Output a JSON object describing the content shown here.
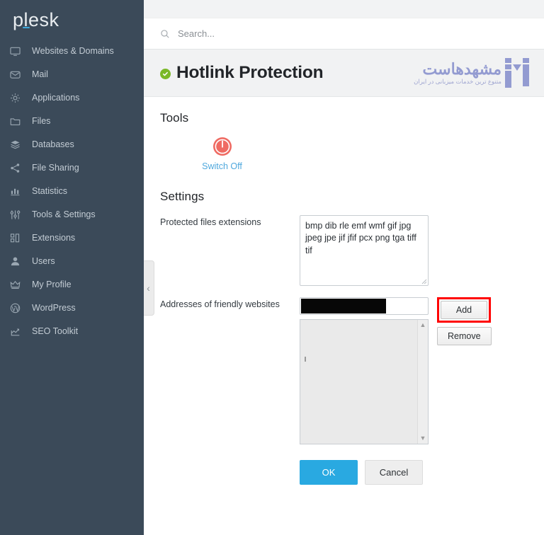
{
  "sidebar": {
    "brand": "plesk",
    "items": [
      {
        "label": "Websites & Domains",
        "icon": "monitor-icon"
      },
      {
        "label": "Mail",
        "icon": "envelope-icon"
      },
      {
        "label": "Applications",
        "icon": "gear-icon"
      },
      {
        "label": "Files",
        "icon": "folder-icon"
      },
      {
        "label": "Databases",
        "icon": "database-layers-icon"
      },
      {
        "label": "File Sharing",
        "icon": "share-nodes-icon"
      },
      {
        "label": "Statistics",
        "icon": "bar-chart-icon"
      },
      {
        "label": "Tools & Settings",
        "icon": "sliders-icon"
      },
      {
        "label": "Extensions",
        "icon": "blocks-icon"
      },
      {
        "label": "Users",
        "icon": "user-icon"
      },
      {
        "label": "My Profile",
        "icon": "crown-icon"
      },
      {
        "label": "WordPress",
        "icon": "wordpress-icon"
      },
      {
        "label": "SEO Toolkit",
        "icon": "seo-chart-icon"
      }
    ],
    "collapse_glyph": "‹"
  },
  "search": {
    "placeholder": "Search...",
    "value": "",
    "icon": "search-icon"
  },
  "page": {
    "title": "Hotlink Protection",
    "status_icon": "green-check-icon",
    "watermark": {
      "title": "مشهدهاست",
      "tagline": "متنوع ترین خدمات میزبانی در ایران"
    }
  },
  "tools": {
    "heading": "Tools",
    "switch_off": {
      "label": "Switch Off",
      "icon": "power-off-icon"
    }
  },
  "settings": {
    "heading": "Settings",
    "protected_extensions": {
      "label": "Protected files extensions",
      "value": "bmp dib rle emf wmf gif jpg jpeg jpe jif jfif pcx png tga tiff tif",
      "placeholder": ""
    },
    "friendly_websites": {
      "label": "Addresses of friendly websites",
      "input_value": "",
      "input_placeholder": "",
      "redacted": true,
      "add_label": "Add",
      "remove_label": "Remove",
      "list_items": [],
      "scroll_up_glyph": "▲",
      "scroll_down_glyph": "▼"
    }
  },
  "footer": {
    "ok_label": "OK",
    "cancel_label": "Cancel"
  },
  "colors": {
    "sidebar_bg": "#3b4a59",
    "accent_blue": "#29a9e1",
    "link_blue": "#4fa8dd",
    "status_green": "#7ab828",
    "power_red": "#ef6b63",
    "highlight_red": "#ff0000",
    "watermark_purple": "#8c94cf"
  }
}
